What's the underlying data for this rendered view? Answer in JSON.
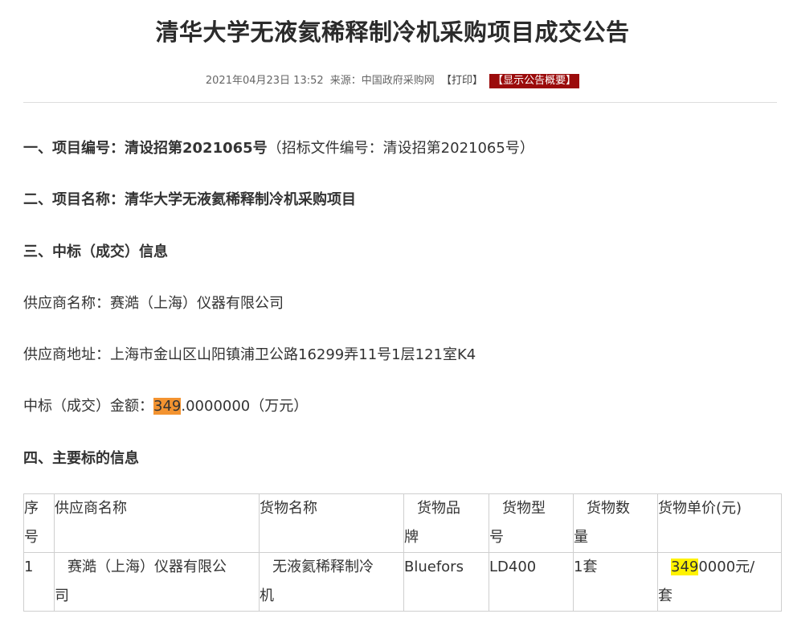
{
  "header": {
    "title": "清华大学无液氦稀释制冷机采购项目成交公告",
    "datetime": "2021年04月23日 13:52",
    "source_label": "来源：",
    "source": "中国政府采购网",
    "print_label": "【打印】",
    "summary_button": "【显示公告概要】"
  },
  "sections": {
    "s1_label": "一、项目编号：",
    "s1_value": "清设招第2021065号",
    "s1_extra": "（招标文件编号：清设招第2021065号）",
    "s2_label": "二、项目名称：",
    "s2_value": "清华大学无液氦稀释制冷机采购项目",
    "s3_heading": "三、中标（成交）信息",
    "supplier_name_label": "供应商名称：",
    "supplier_name": "赛澔（上海）仪器有限公司",
    "supplier_addr_label": "供应商地址：",
    "supplier_addr": "上海市金山区山阳镇浦卫公路16299弄11号1层121室K4",
    "amount_label": "中标（成交）金额：",
    "amount_highlight": "349",
    "amount_rest": ".0000000（万元）",
    "s4_heading": "四、主要标的信息"
  },
  "table": {
    "headers": {
      "no_a": "序",
      "no_b": "号",
      "supplier": "供应商名称",
      "goods": "货物名称",
      "brand_a": "货物品",
      "brand_b": "牌",
      "model_a": "货物型",
      "model_b": "号",
      "qty_a": "货物数",
      "qty_b": "量",
      "price": "货物单价(元)"
    },
    "row": {
      "no": "1",
      "supplier_a": "赛澔（上海）仪器有限公",
      "supplier_b": "司",
      "goods_a": "无液氦稀释制冷",
      "goods_b": "机",
      "brand": "Bluefors",
      "model": "LD400",
      "qty": "1套",
      "price_highlight": "349",
      "price_rest_a": "0000元/",
      "price_rest_b": "套"
    }
  }
}
